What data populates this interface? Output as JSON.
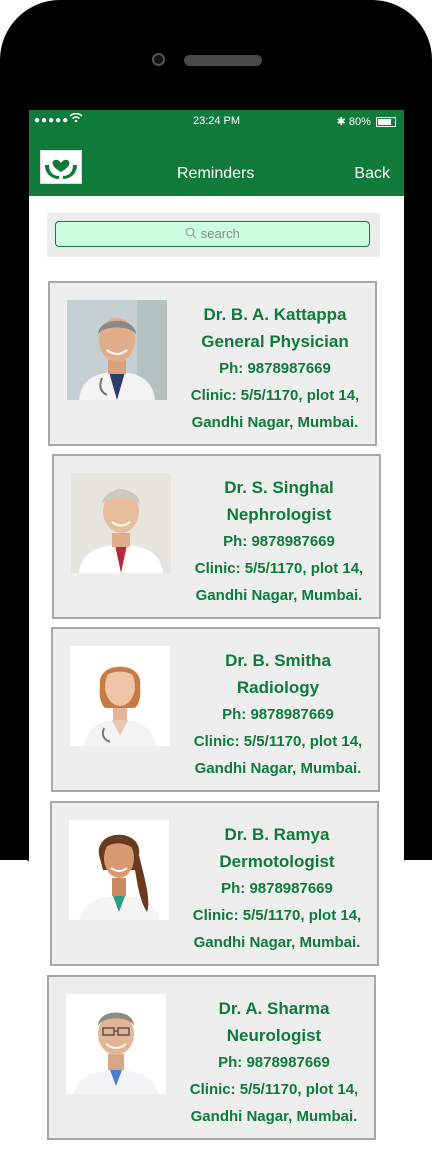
{
  "status_bar": {
    "signal": "●●●●●",
    "time": "23:24 PM",
    "battery_text": "80%"
  },
  "navbar": {
    "title": "Reminders",
    "back_label": "Back",
    "bg_color": "#0f7a3a"
  },
  "search": {
    "placeholder": "search"
  },
  "doctors": [
    {
      "name": "Dr. B. A. Kattappa",
      "specialty": "General Physician",
      "phone": "Ph: 9878987669",
      "clinic_line1": "Clinic: 5/5/1170, plot 14,",
      "clinic_line2": "Gandhi Nagar, Mumbai."
    },
    {
      "name": "Dr. S. Singhal",
      "specialty": "Nephrologist",
      "phone": "Ph: 9878987669",
      "clinic_line1": "Clinic: 5/5/1170, plot 14,",
      "clinic_line2": "Gandhi Nagar, Mumbai."
    },
    {
      "name": "Dr. B. Smitha",
      "specialty": "Radiology",
      "phone": "Ph: 9878987669",
      "clinic_line1": "Clinic: 5/5/1170, plot 14,",
      "clinic_line2": "Gandhi Nagar, Mumbai."
    },
    {
      "name": "Dr. B. Ramya",
      "specialty": "Dermotologist",
      "phone": "Ph: 9878987669",
      "clinic_line1": "Clinic: 5/5/1170, plot 14,",
      "clinic_line2": "Gandhi Nagar, Mumbai."
    },
    {
      "name": "Dr. A. Sharma",
      "specialty": "Neurologist",
      "phone": "Ph: 9878987669",
      "clinic_line1": "Clinic: 5/5/1170, plot 14,",
      "clinic_line2": "Gandhi Nagar, Mumbai."
    }
  ]
}
